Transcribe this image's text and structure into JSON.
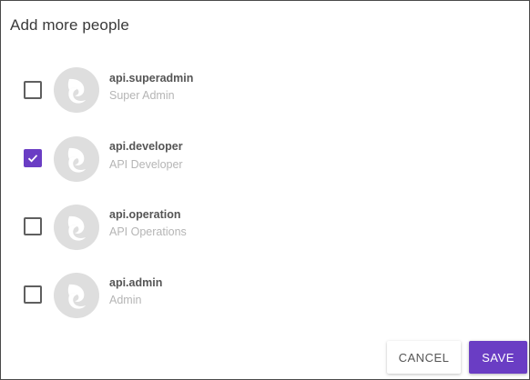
{
  "dialog": {
    "title": "Add more people",
    "accent_color": "#6a3dc4",
    "cancel_label": "CANCEL",
    "save_label": "SAVE"
  },
  "people": [
    {
      "name": "api.superadmin",
      "role": "Super Admin",
      "checked": false,
      "avatar_icon": "default-avatar-icon"
    },
    {
      "name": "api.developer",
      "role": "API Developer",
      "checked": true,
      "avatar_icon": "default-avatar-icon"
    },
    {
      "name": "api.operation",
      "role": "API Operations",
      "checked": false,
      "avatar_icon": "default-avatar-icon"
    },
    {
      "name": "api.admin",
      "role": "Admin",
      "checked": false,
      "avatar_icon": "default-avatar-icon"
    }
  ]
}
